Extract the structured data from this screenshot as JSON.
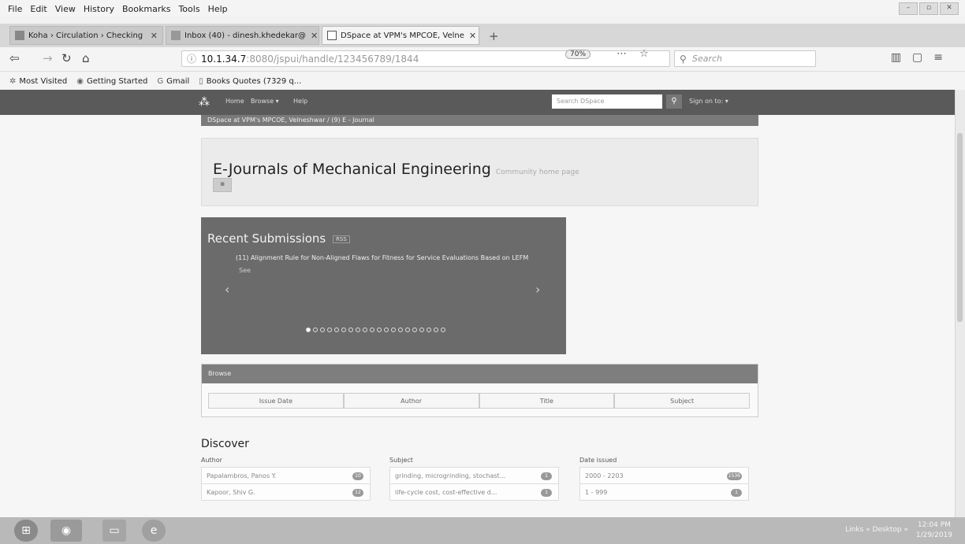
{
  "menu": [
    "File",
    "Edit",
    "View",
    "History",
    "Bookmarks",
    "Tools",
    "Help"
  ],
  "tabs": [
    {
      "label": "Koha › Circulation › Checking",
      "close": "✕"
    },
    {
      "label": "Inbox (40) - dinesh.khedekar@",
      "close": "✕"
    },
    {
      "label": "DSpace at VPM's MPCOE, Velne",
      "close": "✕"
    }
  ],
  "address": {
    "host": "10.1.34.7",
    "path": ":8080/jspui/handle/123456789/1844",
    "zoom": "70%"
  },
  "search_placeholder": "Search",
  "bookmarks": [
    {
      "icon": "gear-icon",
      "label": "Most Visited"
    },
    {
      "icon": "firefox-icon",
      "label": "Getting Started"
    },
    {
      "icon": "google-icon",
      "label": "Gmail"
    },
    {
      "icon": "bookmark-icon",
      "label": "Books Quotes (7329 q..."
    }
  ],
  "dspace": {
    "nav": {
      "home": "Home",
      "browse": "Browse ▾",
      "help": "Help",
      "search_placeholder": "Search DSpace",
      "signon": "Sign on to: ▾"
    },
    "breadcrumb": "DSpace at VPM's MPCOE, Velneshwar  /  (9) E - Journal",
    "community_title": "E-Journals of Mechanical Engineering",
    "community_sub": "Community home page",
    "recent": {
      "title": "Recent Submissions",
      "badge": "RSS",
      "item": "(11) Alignment Rule for Non-Aligned Flaws for Fitness for Service Evaluations Based on LEFM",
      "see": "See",
      "dots": 20
    },
    "browse": {
      "header": "Browse",
      "buttons": [
        "Issue Date",
        "Author",
        "Title",
        "Subject"
      ]
    },
    "discover": {
      "title": "Discover",
      "facets": [
        {
          "head": "Author",
          "rows": [
            {
              "label": "Papalambros, Panos Y.",
              "count": "10"
            },
            {
              "label": "Kapoor, Shiv G.",
              "count": "12"
            }
          ]
        },
        {
          "head": "Subject",
          "rows": [
            {
              "label": "grinding, microgrinding, stochast...",
              "count": "1"
            },
            {
              "label": "life-cycle cost, cost-effective d...",
              "count": "1"
            }
          ]
        },
        {
          "head": "Date issued",
          "rows": [
            {
              "label": "2000 - 2203",
              "count": "1536"
            },
            {
              "label": "1 - 999",
              "count": "1"
            }
          ]
        }
      ]
    }
  },
  "taskbar": {
    "tray": "Links »  Desktop »",
    "time": "12:04 PM",
    "date": "1/29/2019"
  }
}
